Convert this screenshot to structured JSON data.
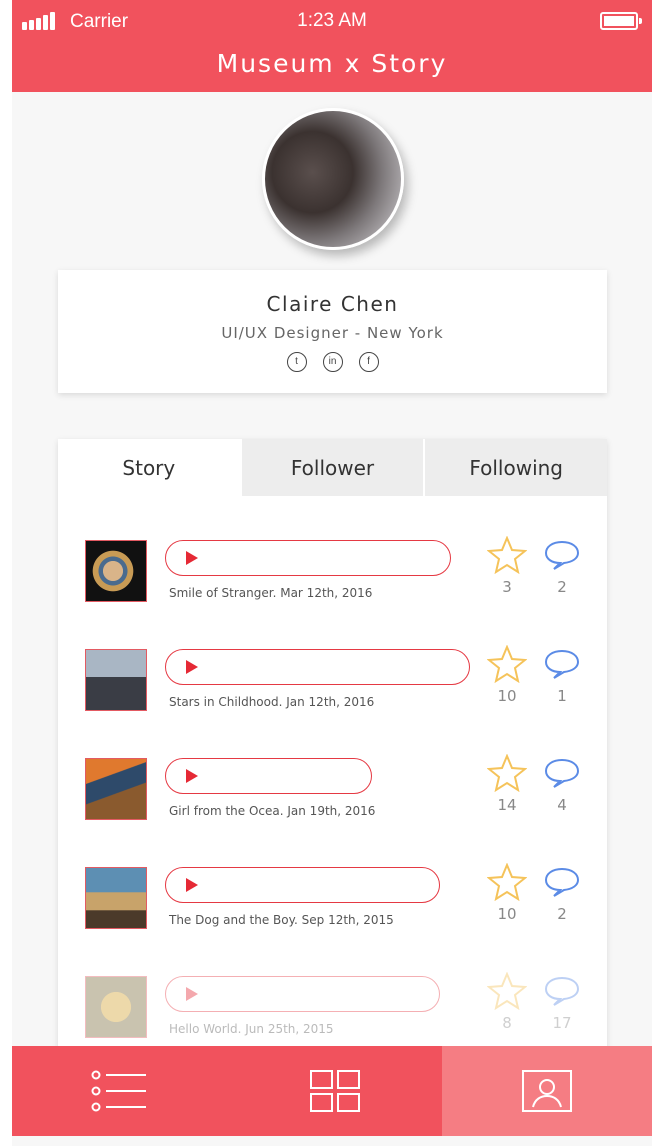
{
  "status_bar": {
    "carrier": "Carrier",
    "time": "1:23 AM"
  },
  "header": {
    "title": "Museum x Story"
  },
  "profile": {
    "name": "Claire Chen",
    "role": "UI/UX Designer - New York",
    "socials": [
      {
        "icon": "twitter-icon",
        "glyph": "t"
      },
      {
        "icon": "linkedin-icon",
        "glyph": "in"
      },
      {
        "icon": "facebook-icon",
        "glyph": "f"
      }
    ]
  },
  "tabs": [
    {
      "label": "Story",
      "active": true
    },
    {
      "label": "Follower",
      "active": false
    },
    {
      "label": "Following",
      "active": false
    }
  ],
  "stories": [
    {
      "caption": "Smile of Stranger. Mar 12th, 2016",
      "stars": "3",
      "comments": "2",
      "artwork": "girl-with-pearl-earring"
    },
    {
      "caption": "Stars in Childhood. Jan 12th, 2016",
      "stars": "10",
      "comments": "1",
      "artwork": "son-of-man"
    },
    {
      "caption": "Girl from the Ocea. Jan 19th, 2016",
      "stars": "14",
      "comments": "4",
      "artwork": "the-scream"
    },
    {
      "caption": "The Dog and the Boy. Sep 12th, 2015",
      "stars": "10",
      "comments": "2",
      "artwork": "persistence-of-memory"
    },
    {
      "caption": "Hello World. Jun 25th, 2015",
      "stars": "8",
      "comments": "17",
      "artwork": "the-kiss"
    }
  ],
  "bottom_nav": [
    {
      "icon": "list-icon",
      "active": false
    },
    {
      "icon": "grid-icon",
      "active": false
    },
    {
      "icon": "profile-card-icon",
      "active": true
    }
  ],
  "colors": {
    "brand": "#f1525d",
    "brand_active": "#f57d83",
    "player_accent": "#e53943",
    "star": "#f5c35a",
    "comment": "#5b8be6"
  }
}
